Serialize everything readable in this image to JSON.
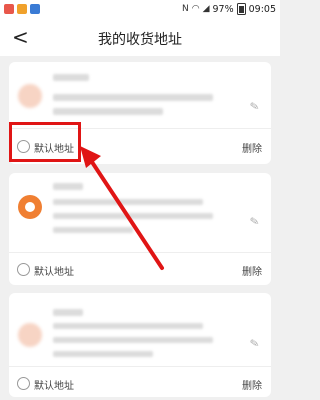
{
  "status_bar": {
    "battery": "97%",
    "time": "09:05",
    "icons": [
      "app-icon-1",
      "app-icon-2",
      "app-icon-3",
      "nfc-icon",
      "wifi-icon",
      "signal-icon",
      "battery-icon"
    ],
    "battery_level": 0.97
  },
  "nav": {
    "back_symbol": "<",
    "title": "我的收货地址"
  },
  "addresses": [
    {
      "default_label": "默认地址",
      "delete_label": "删除",
      "avatar": "pale",
      "text_blurred": true
    },
    {
      "default_label": "默认地址",
      "delete_label": "删除",
      "avatar": "orange",
      "text_blurred": true
    },
    {
      "default_label": "默认地址",
      "delete_label": "删除",
      "avatar": "pale",
      "text_blurred": true
    }
  ],
  "colors": {
    "accent_orange": "#f07f32",
    "annotation_red": "#e01515",
    "background": "#f0f0f0"
  }
}
